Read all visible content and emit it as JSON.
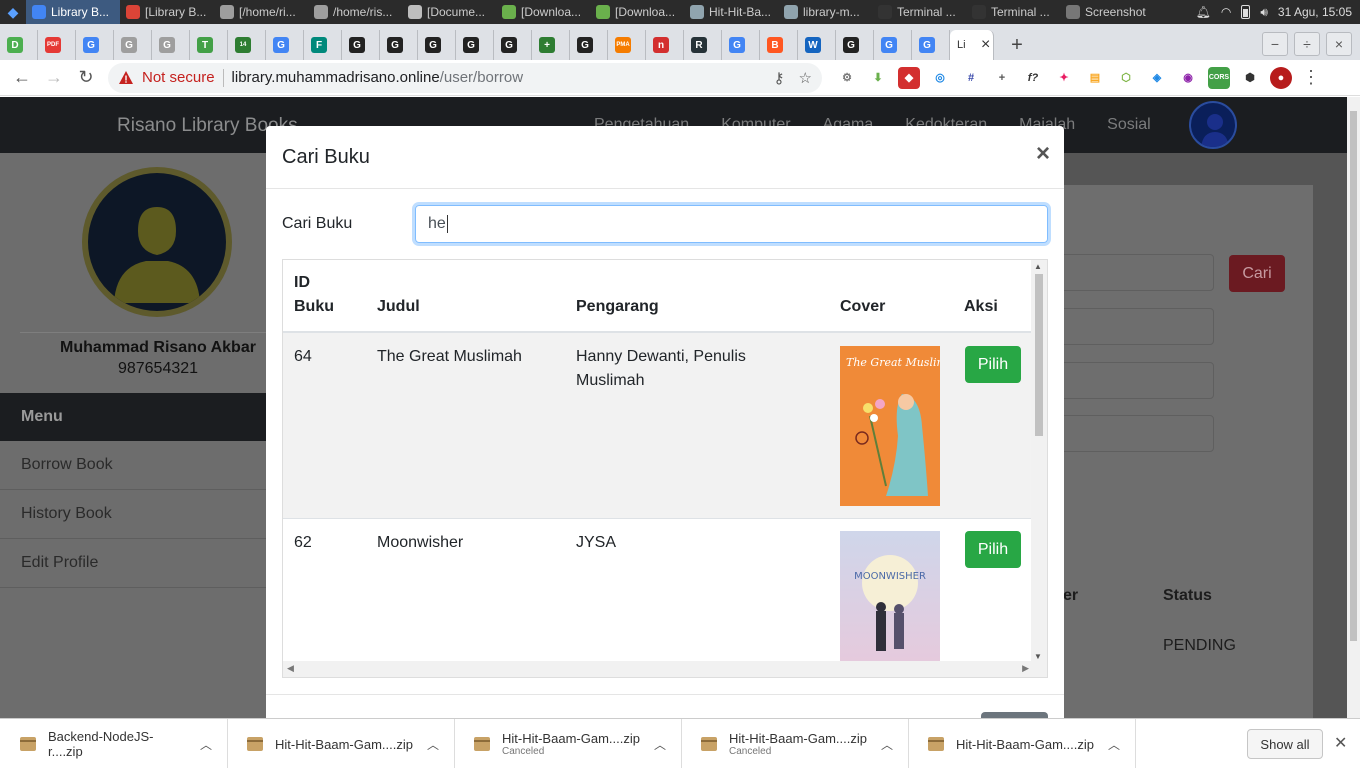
{
  "os": {
    "tasks": [
      {
        "label": "Library B...",
        "color": "#4285f4"
      },
      {
        "label": "[Library B...",
        "color": "#db4437"
      },
      {
        "label": "[/home/ri...",
        "color": "#9e9e9e"
      },
      {
        "label": "/home/ris...",
        "color": "#9e9e9e"
      },
      {
        "label": "[Docume...",
        "color": "#bdbdbd"
      },
      {
        "label": "[Downloa...",
        "color": "#6ab04c"
      },
      {
        "label": "[Downloa...",
        "color": "#6ab04c"
      },
      {
        "label": "Hit-Hit-Ba...",
        "color": "#90a4ae"
      },
      {
        "label": "library-m...",
        "color": "#90a4ae"
      },
      {
        "label": "Terminal ...",
        "color": "#333333"
      },
      {
        "label": "Terminal ...",
        "color": "#333333"
      },
      {
        "label": "Screenshot",
        "color": "#777777"
      }
    ],
    "datetime": "31 Agu, 15:05"
  },
  "browser": {
    "tabs": [
      {
        "letter": "D",
        "color": "#4caf50"
      },
      {
        "letter": "PDF",
        "color": "#e53935"
      },
      {
        "letter": "G",
        "color": "#4285f4"
      },
      {
        "letter": "G",
        "color": "#9e9e9e"
      },
      {
        "letter": "G",
        "color": "#9e9e9e"
      },
      {
        "letter": "T",
        "color": "#43a047"
      },
      {
        "letter": "14",
        "color": "#2e7d32"
      },
      {
        "letter": "G",
        "color": "#4285f4"
      },
      {
        "letter": "F",
        "color": "#00897b"
      },
      {
        "letter": "G",
        "color": "#222222"
      },
      {
        "letter": "G",
        "color": "#222222"
      },
      {
        "letter": "G",
        "color": "#222222"
      },
      {
        "letter": "G",
        "color": "#222222"
      },
      {
        "letter": "G",
        "color": "#222222"
      },
      {
        "letter": "+",
        "color": "#2e7d32"
      },
      {
        "letter": "G",
        "color": "#222222"
      },
      {
        "letter": "PMA",
        "color": "#f57c00"
      },
      {
        "letter": "n",
        "color": "#d32f2f"
      },
      {
        "letter": "R",
        "color": "#263238"
      },
      {
        "letter": "G",
        "color": "#4285f4"
      },
      {
        "letter": "B",
        "color": "#ff5722"
      },
      {
        "letter": "W",
        "color": "#1565c0"
      },
      {
        "letter": "G",
        "color": "#222222"
      },
      {
        "letter": "G",
        "color": "#4285f4"
      },
      {
        "letter": "G",
        "color": "#4285f4"
      }
    ],
    "active_tab_letter": "Li",
    "not_secure": "Not secure",
    "url_host": "library.muhammadrisano.online",
    "url_path": "/user/borrow"
  },
  "page": {
    "brand": "Risano Library Books",
    "nav_links": [
      "Pengetahuan",
      "Komputer",
      "Agama",
      "Kedokteran",
      "Majalah",
      "Sosial"
    ],
    "profile_name": "Muhammad Risano Akbar",
    "profile_id": "987654321",
    "menu_title": "Menu",
    "menu_items": [
      "Borrow Book",
      "History Book",
      "Edit Profile"
    ],
    "cari_button": "Cari",
    "er_head": "er",
    "status_head": "Status",
    "status_value": "PENDING"
  },
  "modal": {
    "title": "Cari Buku",
    "close": "×",
    "search_label": "Cari Buku",
    "search_value": "he",
    "headers": {
      "id_line1": "ID",
      "id_line2": "Buku",
      "judul": "Judul",
      "pengarang": "Pengarang",
      "cover": "Cover",
      "aksi": "Aksi"
    },
    "rows": [
      {
        "id": "64",
        "judul": "The Great Muslimah",
        "pengarang": "Hanny Dewanti, Penulis Muslimah",
        "cover_title": "The Great Muslimah",
        "aksi": "Pilih"
      },
      {
        "id": "62",
        "judul": "Moonwisher",
        "pengarang": "JYSA",
        "cover_title": "MOONWISHER",
        "aksi": "Pilih"
      }
    ]
  },
  "downloads": {
    "items": [
      {
        "name": "Backend-NodeJS-r....zip",
        "status": ""
      },
      {
        "name": "Hit-Hit-Baam-Gam....zip",
        "status": ""
      },
      {
        "name": "Hit-Hit-Baam-Gam....zip",
        "status": "Canceled"
      },
      {
        "name": "Hit-Hit-Baam-Gam....zip",
        "status": "Canceled"
      },
      {
        "name": "Hit-Hit-Baam-Gam....zip",
        "status": ""
      }
    ],
    "show_all": "Show all"
  }
}
